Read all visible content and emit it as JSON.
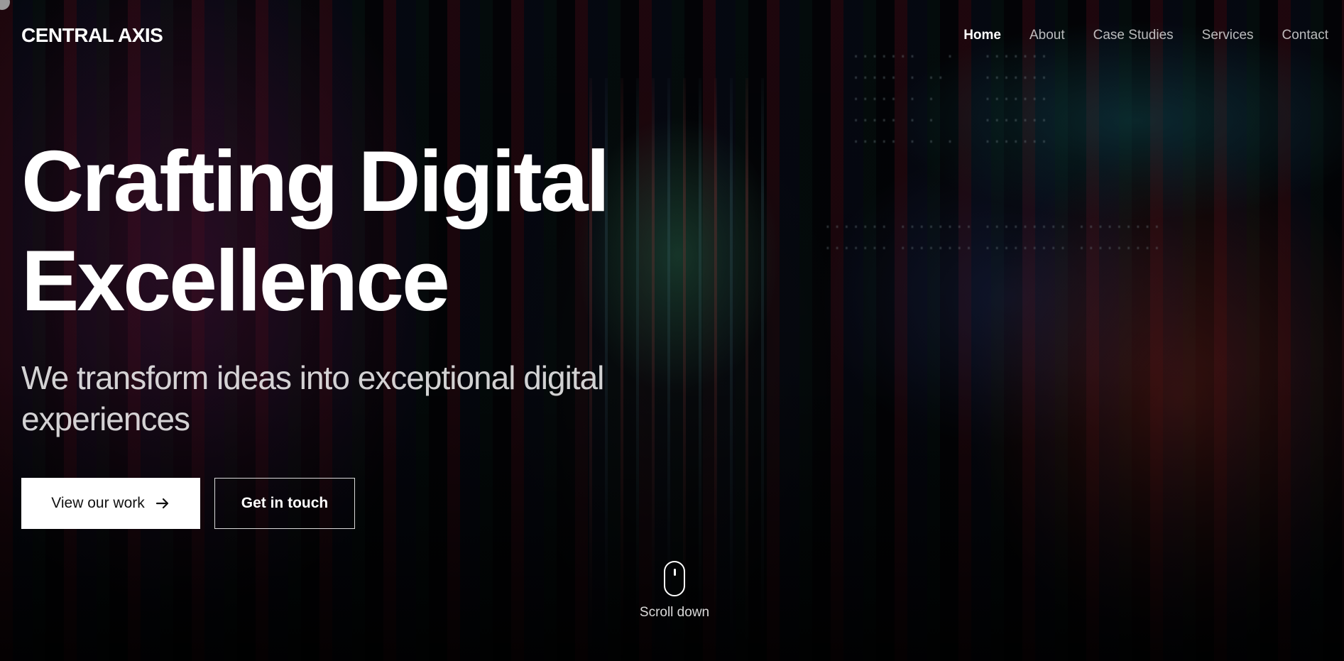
{
  "brand": {
    "name": "CENTRAL AXIS"
  },
  "nav": {
    "items": [
      {
        "label": "Home",
        "active": true
      },
      {
        "label": "About",
        "active": false
      },
      {
        "label": "Case Studies",
        "active": false
      },
      {
        "label": "Services",
        "active": false
      },
      {
        "label": "Contact",
        "active": false
      }
    ]
  },
  "hero": {
    "headline_line1": "Crafting Digital",
    "headline_line2": "Excellence",
    "subheadline": "We transform ideas into exceptional digital experiences",
    "primary_button": {
      "label": "View our work",
      "icon": "arrow-right-icon"
    },
    "secondary_button": {
      "label": "Get in touch"
    }
  },
  "scroll": {
    "label": "Scroll down",
    "icon": "mouse-icon"
  },
  "colors": {
    "text": "#ffffff",
    "primary_button_bg": "#ffffff",
    "primary_button_text": "#111111",
    "nav_inactive": "#b8b8b8"
  }
}
